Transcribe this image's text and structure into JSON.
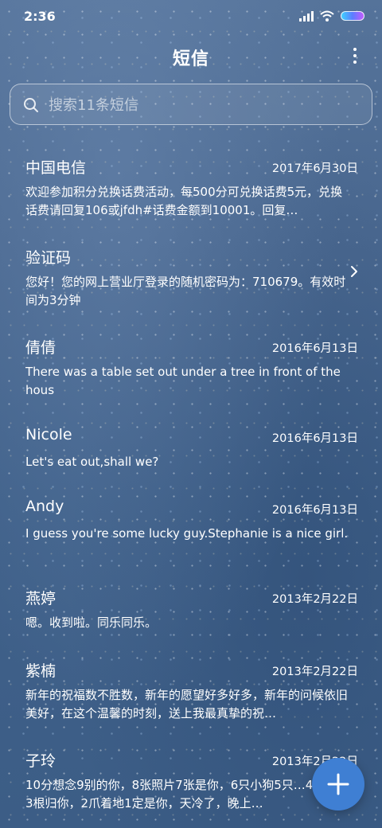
{
  "status_bar": {
    "time": "2:36",
    "icons": [
      "signal-icon",
      "wifi-icon",
      "battery-icon"
    ]
  },
  "header": {
    "title": "短信",
    "menu_icon": "more-vertical-icon"
  },
  "search": {
    "placeholder": "搜索11条短信",
    "icon": "search-icon"
  },
  "messages": [
    {
      "name": "中国电信",
      "date": "2017年6月30日",
      "preview": "欢迎参加积分兑换话费活动，每500分可兑换话费5元，兑换话费请回复106或jfdh#话费金额到10001。回复…"
    },
    {
      "name": "验证码",
      "date": "",
      "preview": "您好！您的网上营业厅登录的随机密码为：710679。有效时间为3分钟",
      "trailing_icon": "chevron-right-icon"
    },
    {
      "name": "倩倩",
      "date": "2016年6月13日",
      "preview": "There was a table set out under a tree in front of the hous"
    },
    {
      "name": "Nicole",
      "date": "2016年6月13日",
      "preview": "Let's eat out,shall we?"
    },
    {
      "name": "Andy",
      "date": "2016年6月13日",
      "preview": "I guess you're some lucky guy.Stephanie is a nice girl."
    },
    {
      "name": "燕婷",
      "date": "2013年2月22日",
      "preview": "嗯。收到啦。同乐同乐。"
    },
    {
      "name": "紫楠",
      "date": "2013年2月22日",
      "preview": "新年的祝福数不胜数，新年的愿望好多好多，新年的问候依旧美好，在这个温馨的时刻，送上我最真挚的祝…"
    },
    {
      "name": "子玲",
      "date": "2013年2月22日",
      "preview": "10分想念9别的你，8张照片7张是你，6只小狗5只…4根骨头3根归你，2爪着地1定是你，天冷了，晚上…"
    }
  ],
  "fab": {
    "icon": "plus-icon"
  },
  "colors": {
    "fab": "#3f7fd3",
    "text": "#ffffff"
  }
}
